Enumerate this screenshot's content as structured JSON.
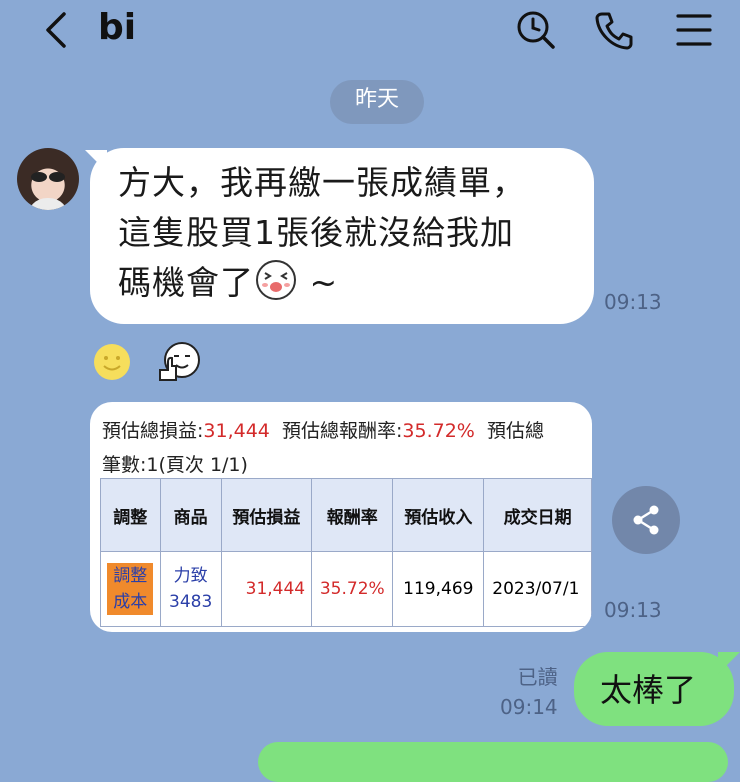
{
  "header": {
    "title": "bi",
    "icons": [
      "back-arrow-icon",
      "search-icon",
      "phone-icon",
      "menu-icon"
    ]
  },
  "date_separator": "昨天",
  "messages": {
    "incoming_text": {
      "lines": [
        "方大，我再繳一張成績單，",
        "這隻股買1張後就沒給我加",
        "碼機會了"
      ],
      "suffix": " ~",
      "time": "09:13"
    },
    "incoming_card": {
      "summary": {
        "label1": "預估總損益:",
        "value1": "31,444",
        "label2": "預估總報酬率:",
        "value2": "35.72%",
        "label3": "預估總"
      },
      "count_line": "筆數:1(頁次 1/1)",
      "table": {
        "headers": [
          "調整",
          "商品",
          "預估損益",
          "報酬率",
          "預估收入",
          "成交日期"
        ],
        "row": {
          "adjust_line1": "調整",
          "adjust_line2": "成本",
          "product_name": "力致",
          "product_code": "3483",
          "pnl": "31,444",
          "return_rate": "35.72%",
          "income": "119,469",
          "date": "2023/07/1"
        }
      },
      "time": "09:13"
    },
    "outgoing": {
      "read_label": "已讀",
      "time": "09:14",
      "text": "太棒了"
    }
  },
  "colors": {
    "background": "#8aa9d4",
    "outgoing_bubble": "#7fe17f",
    "accent_red": "#d32a2a",
    "adjust_button": "#f08a2c"
  }
}
